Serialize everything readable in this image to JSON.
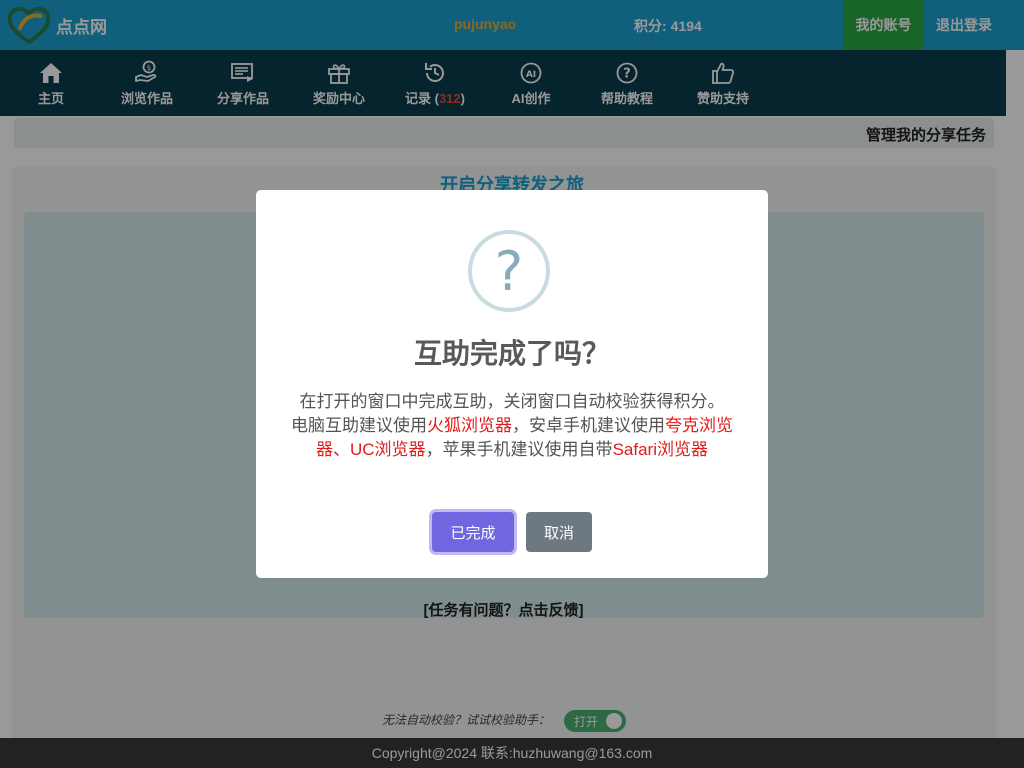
{
  "header": {
    "logo_text": "点点网",
    "username": "pujunyao",
    "points_label": "积分:",
    "points_value": "4194",
    "account_button": "我的账号",
    "logout_button": "退出登录"
  },
  "nav": {
    "items": [
      {
        "label": "主页",
        "icon": "home-icon"
      },
      {
        "label": "浏览作品",
        "icon": "hand-coin-icon"
      },
      {
        "label": "分享作品",
        "icon": "share-list-icon"
      },
      {
        "label": "奖励中心",
        "icon": "gift-icon"
      },
      {
        "label": "记录 (",
        "count": "312",
        "suffix": ")",
        "icon": "history-icon"
      },
      {
        "label": "AI创作",
        "icon": "ai-icon"
      },
      {
        "label": "帮助教程",
        "icon": "help-icon"
      },
      {
        "label": "赞助支持",
        "icon": "thumbs-up-icon"
      }
    ]
  },
  "content": {
    "manage_title": "管理我的分享任务",
    "journey_title": "开启分享转发之旅",
    "feedback_link": "[任务有问题？点击反馈]",
    "auto_check_text": "无法自动校验？试试校验助手：",
    "toggle_label": "打开"
  },
  "footer": {
    "copyright": "Copyright@2024 联系:huzhuwang@163.com"
  },
  "modal": {
    "icon_glyph": "?",
    "title": "互助完成了吗？",
    "body_line1": "在打开的窗口中完成互助，关闭窗口自动校验获得积分。",
    "body_p2_a": "电脑互助建议使用",
    "body_p2_firefox": "火狐浏览器",
    "body_p2_b": "，安卓手机建议使用",
    "body_p2_quark": "夸克浏览器、UC浏览器",
    "body_p2_c": "，苹果手机建议使用自带",
    "body_p2_safari": "Safari浏览器",
    "confirm_button": "已完成",
    "cancel_button": "取消"
  },
  "colors": {
    "topbar": "#1a9fd0",
    "navbar": "#0a3d4c",
    "account_green": "#28a745",
    "username_orange": "#f0ad2d",
    "confirm_purple": "#7066e0",
    "cancel_gray": "#6e7881",
    "highlight_red": "#e21b1b"
  }
}
